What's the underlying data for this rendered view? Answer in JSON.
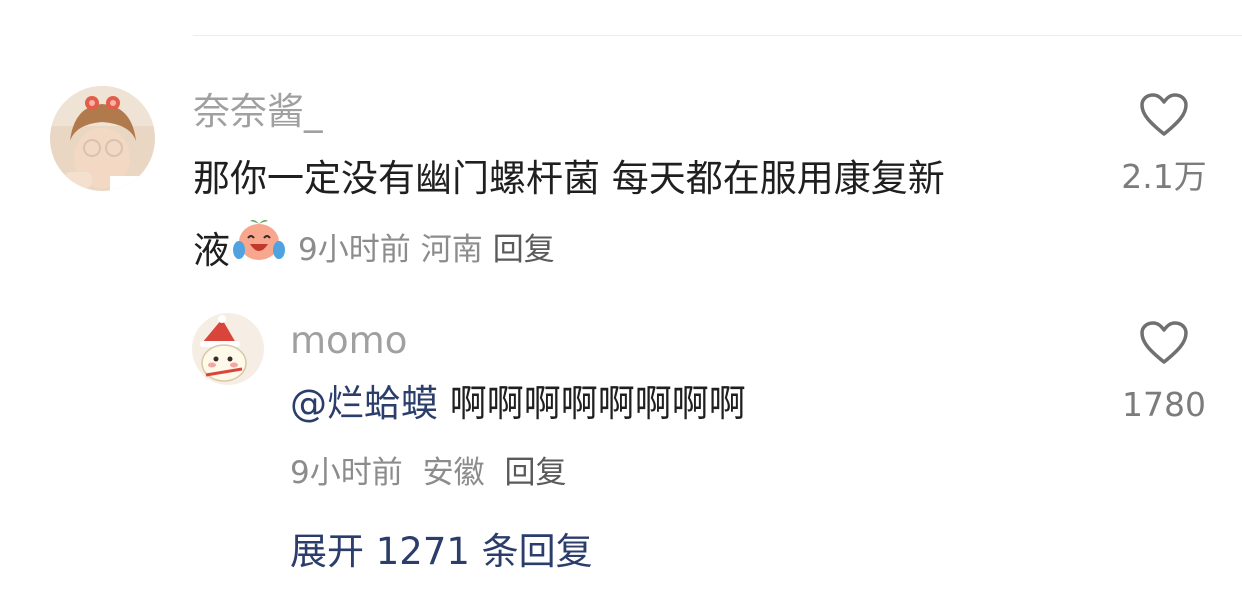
{
  "comment": {
    "username": "奈奈酱_",
    "text_line1": "那你一定没有幽门螺杆菌 每天都在服用康复新",
    "text_line2": "液",
    "emoji_icon": "crying-laughing-face-emoji-icon",
    "time": "9小时前",
    "location": "河南",
    "reply_label": "回复",
    "like_count": "2.1万"
  },
  "reply": {
    "username": "momo",
    "mention": "@烂蛤蟆",
    "text": "啊啊啊啊啊啊啊啊",
    "time": "9小时前",
    "location": "安徽",
    "reply_label": "回复",
    "like_count": "1780"
  },
  "expand_label": "展开 1271 条回复",
  "colors": {
    "link": "#2b3d6b",
    "username": "#a0a0a0",
    "meta": "#8c8c8c",
    "body_text": "#1f1f1f"
  }
}
